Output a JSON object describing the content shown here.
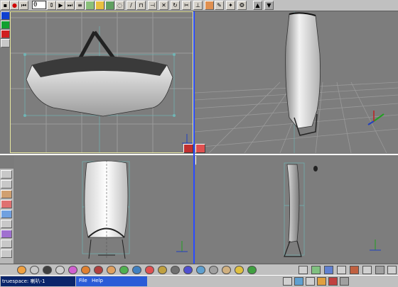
{
  "app": {
    "title": "truespace",
    "document": "喇叭-1"
  },
  "toolbar": {
    "frame_value": "0"
  },
  "menu": {
    "items": [
      "File",
      "Help"
    ]
  },
  "icons": {
    "record": "record-icon",
    "rewind": "rewind-icon",
    "play": "play-icon",
    "forward": "fast-forward-icon"
  },
  "colors": {
    "selection_frame": "#e8e8a0",
    "viewport_divider": "#2a4cff",
    "grid": "#9a9a9a",
    "taskbar_active": "#0a246a"
  }
}
